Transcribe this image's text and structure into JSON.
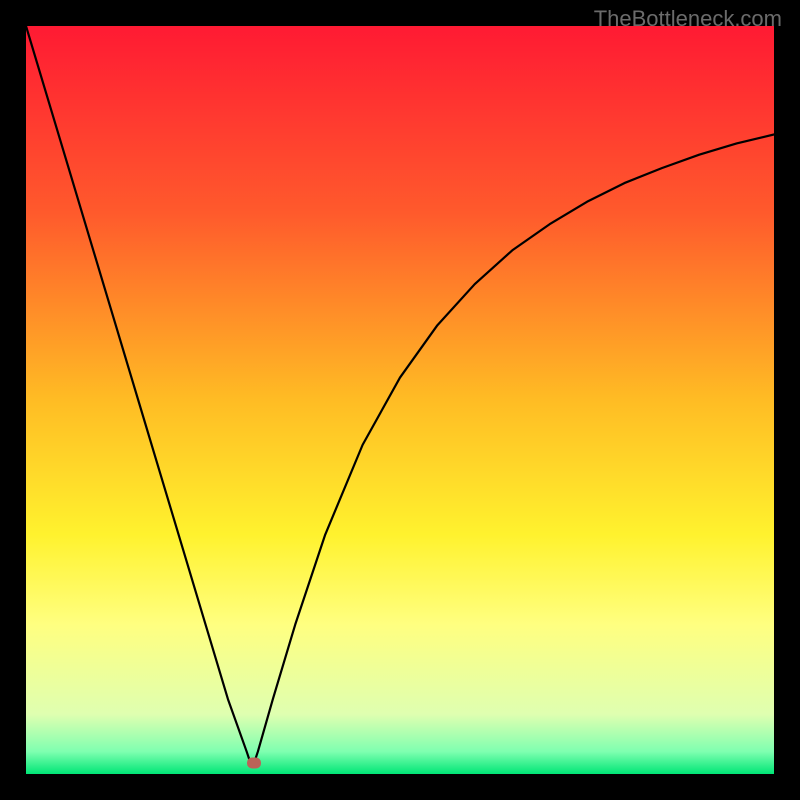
{
  "watermark": "TheBottleneck.com",
  "chart_data": {
    "type": "line",
    "title": "",
    "xlabel": "",
    "ylabel": "",
    "xlim": [
      0,
      100
    ],
    "ylim": [
      0,
      100
    ],
    "background": {
      "type": "gradient-vertical",
      "stops": [
        {
          "pos": 0,
          "color": "#ff1a33"
        },
        {
          "pos": 25,
          "color": "#ff5a2c"
        },
        {
          "pos": 50,
          "color": "#ffbc24"
        },
        {
          "pos": 68,
          "color": "#fff22e"
        },
        {
          "pos": 80,
          "color": "#ffff80"
        },
        {
          "pos": 92,
          "color": "#dfffb0"
        },
        {
          "pos": 97,
          "color": "#7fffb0"
        },
        {
          "pos": 100,
          "color": "#00e676"
        }
      ]
    },
    "series": [
      {
        "name": "bottleneck-curve",
        "color": "#000000",
        "x": [
          0,
          3,
          6,
          9,
          12,
          15,
          18,
          21,
          24,
          27,
          29.5,
          30,
          30.5,
          31,
          33,
          36,
          40,
          45,
          50,
          55,
          60,
          65,
          70,
          75,
          80,
          85,
          90,
          95,
          100
        ],
        "y": [
          100,
          90,
          80,
          70,
          60,
          50,
          40,
          30,
          20,
          10,
          3,
          1.5,
          1.5,
          3,
          10,
          20,
          32,
          44,
          53,
          60,
          65.5,
          70,
          73.5,
          76.5,
          79,
          81,
          82.8,
          84.3,
          85.5
        ]
      }
    ],
    "marker": {
      "x": 30.5,
      "y": 1.5,
      "color": "#bb6358"
    }
  }
}
